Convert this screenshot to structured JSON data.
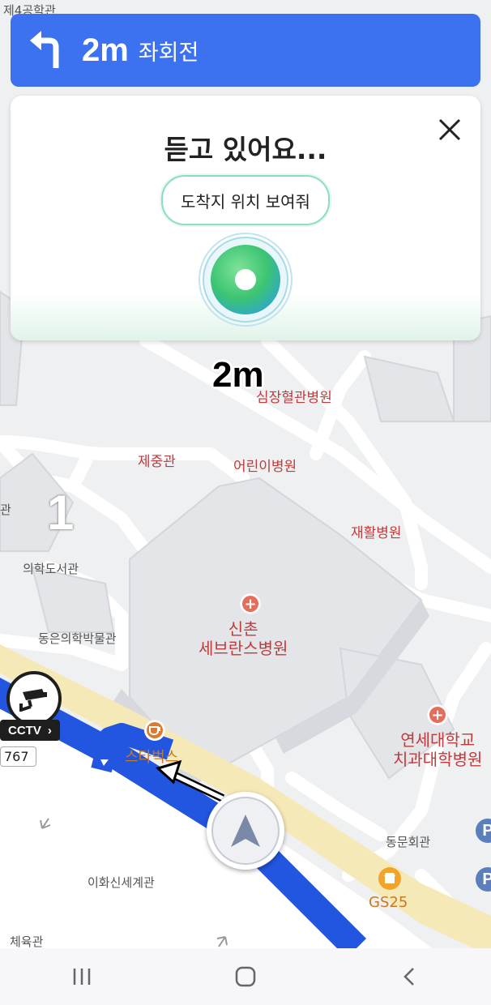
{
  "nav_banner": {
    "distance": "2m",
    "direction": "좌회전",
    "turn_icon": "turn-left-arrow-icon"
  },
  "voice_panel": {
    "title": "듣고 있어요...",
    "suggestion": "도착지 위치 보여줘",
    "close_icon": "close-icon",
    "mic_icon": "microphone-orb-icon"
  },
  "map": {
    "distance_overlay": "2m",
    "lane_number": "1",
    "labels": {
      "top_fourth_hall": "제4공학관",
      "hall_left_edge": "관",
      "cardiovascular_hospital": "심장혈관병원",
      "jejung_hall": "제중관",
      "childrens_hospital": "어린이병원",
      "rehab_hospital": "재활병원",
      "medical_library": "의학도서관",
      "dongeun_museum": "동은의학박물관",
      "severance_hospital_line1": "신촌",
      "severance_hospital_line2": "세브란스병원",
      "starbucks": "스타벅스",
      "dental_hospital_line1": "연세대학교",
      "dental_hospital_line2": "치과대학병원",
      "dongmun_hall": "동문회관",
      "gs25": "GS25",
      "ewha_sinsegye_hall": "이화신세계관",
      "gymnasium": "체육관"
    },
    "cctv_label": "CCTV",
    "road_number": "767",
    "parking_label": "P"
  },
  "colors": {
    "banner": "#3c72ef",
    "route": "#2255e0",
    "road": "#f6e9b8",
    "hospital": "#c13b3b"
  },
  "system_nav": {
    "recents_icon": "recent-apps-icon",
    "home_icon": "home-icon",
    "back_icon": "back-icon"
  }
}
